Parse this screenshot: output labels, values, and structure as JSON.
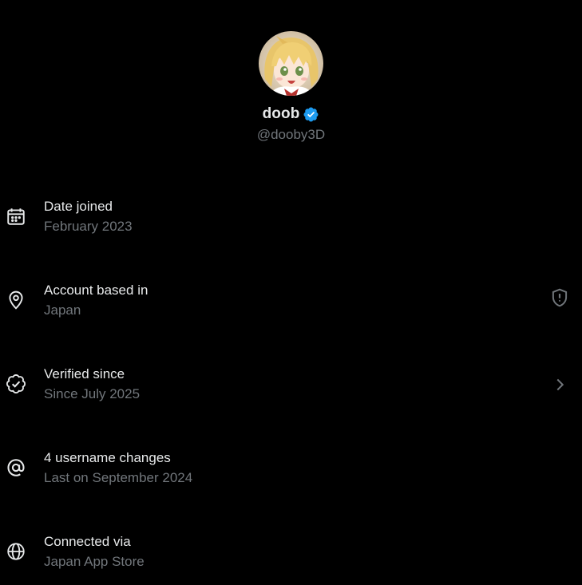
{
  "profile": {
    "name": "doob",
    "handle": "@dooby3D",
    "verified": true,
    "verified_color": "#1d9bf0",
    "avatar_description": "avatar"
  },
  "rows": [
    {
      "icon": "calendar-icon",
      "title": "Date joined",
      "subtitle": "February 2023"
    },
    {
      "icon": "location-pin-icon",
      "title": "Account based in",
      "subtitle": "Japan",
      "trailing_icon": "shield-alert-icon"
    },
    {
      "icon": "verified-check-icon",
      "title": "Verified since",
      "subtitle": "Since July 2025",
      "trailing_icon": "chevron-right-icon"
    },
    {
      "icon": "at-sign-icon",
      "title": "4 username changes",
      "subtitle": "Last on September 2024"
    },
    {
      "icon": "globe-icon",
      "title": "Connected via",
      "subtitle": "Japan App Store"
    }
  ],
  "colors": {
    "background": "#000000",
    "primary_text": "#e7e9ea",
    "secondary_text": "#71767b",
    "accent": "#1d9bf0"
  }
}
